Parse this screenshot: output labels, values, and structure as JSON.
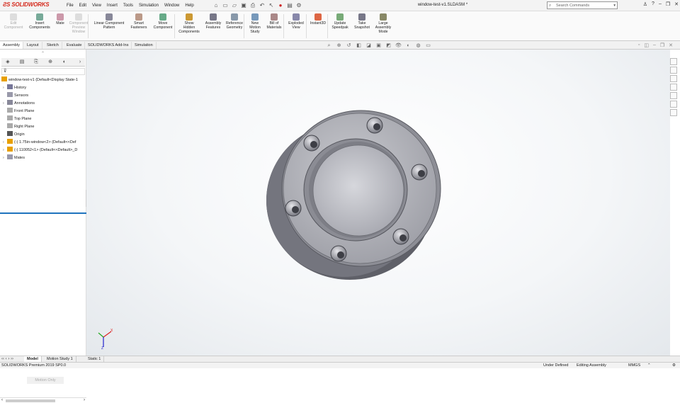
{
  "app": {
    "logo": "SOLIDWORKS",
    "doc_title": "window-test-v1.SLDASM *"
  },
  "menus": [
    "File",
    "Edit",
    "View",
    "Insert",
    "Tools",
    "Simulation",
    "Window",
    "Help"
  ],
  "search": {
    "placeholder": "Search Commands"
  },
  "commands": [
    {
      "label": "Edit Component",
      "enabled": false
    },
    {
      "label": "Insert Components",
      "enabled": true
    },
    {
      "label": "Mate",
      "enabled": true
    },
    {
      "label": "Component Preview Window",
      "enabled": false
    },
    {
      "label": "Linear Component Pattern",
      "enabled": true
    },
    {
      "label": "Smart Fasteners",
      "enabled": true
    },
    {
      "label": "Move Component",
      "enabled": true
    },
    {
      "label": "Show Hidden Components",
      "enabled": true
    },
    {
      "label": "Assembly Features",
      "enabled": true
    },
    {
      "label": "Reference Geometry",
      "enabled": true
    },
    {
      "label": "New Motion Study",
      "enabled": true
    },
    {
      "label": "Bill of Materials",
      "enabled": true
    },
    {
      "label": "Exploded View",
      "enabled": true
    },
    {
      "label": "Instant3D",
      "enabled": true
    },
    {
      "label": "Update Speedpak",
      "enabled": true
    },
    {
      "label": "Take Snapshot",
      "enabled": true
    },
    {
      "label": "Large Assembly Mode",
      "enabled": true
    }
  ],
  "tabs": [
    "Assembly",
    "Layout",
    "Sketch",
    "Evaluate",
    "SOLIDWORKS Add-Ins",
    "Simulation"
  ],
  "tree": [
    {
      "label": "window-test-v1  (Default<Display State-1",
      "expand": false
    },
    {
      "label": "History",
      "expand": true
    },
    {
      "label": "Sensors",
      "expand": false
    },
    {
      "label": "Annotations",
      "expand": true
    },
    {
      "label": "Front Plane",
      "expand": false
    },
    {
      "label": "Top Plane",
      "expand": false
    },
    {
      "label": "Right Plane",
      "expand": false
    },
    {
      "label": "Origin",
      "expand": false
    },
    {
      "label": "(-) 1.75in-window<2> (Default<<Def",
      "expand": true
    },
    {
      "label": "(-) 110052<1> (Default<<Default>_D",
      "expand": true
    },
    {
      "label": "Mates",
      "expand": true
    }
  ],
  "motion_hint": "Motion Only",
  "bottom_tabs": [
    "Model",
    "Motion Study 1",
    "Static 1"
  ],
  "status": {
    "app": "SOLIDWORKS Premium 2019 SP0.0",
    "defined": "Under Defined",
    "mode": "Editing Assembly",
    "units": "MMGS"
  },
  "colors": {
    "brand": "#d52b1e",
    "accent": "#1e73be"
  }
}
